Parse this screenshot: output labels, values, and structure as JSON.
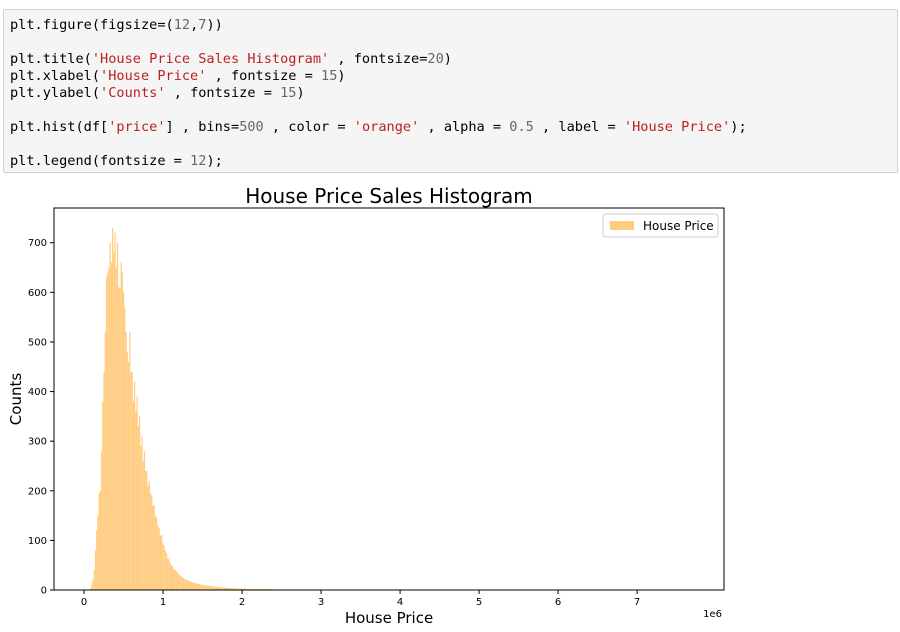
{
  "code_cell": {
    "lines": [
      [
        {
          "t": "plt.figure(figsize=("
        },
        {
          "t": "12",
          "c": "num"
        },
        {
          "t": ","
        },
        {
          "t": "7",
          "c": "num"
        },
        {
          "t": "))"
        }
      ],
      [],
      [
        {
          "t": "plt.title("
        },
        {
          "t": "'House Price Sales Histogram'",
          "c": "str"
        },
        {
          "t": " , fontsize="
        },
        {
          "t": "20",
          "c": "num"
        },
        {
          "t": ")"
        }
      ],
      [
        {
          "t": "plt.xlabel("
        },
        {
          "t": "'House Price'",
          "c": "str"
        },
        {
          "t": " , fontsize = "
        },
        {
          "t": "15",
          "c": "num"
        },
        {
          "t": ")"
        }
      ],
      [
        {
          "t": "plt.ylabel("
        },
        {
          "t": "'Counts'",
          "c": "str"
        },
        {
          "t": " , fontsize = "
        },
        {
          "t": "15",
          "c": "num"
        },
        {
          "t": ")"
        }
      ],
      [],
      [
        {
          "t": "plt.hist(df["
        },
        {
          "t": "'price'",
          "c": "str"
        },
        {
          "t": "] , bins="
        },
        {
          "t": "500",
          "c": "num"
        },
        {
          "t": " , color = "
        },
        {
          "t": "'orange'",
          "c": "str"
        },
        {
          "t": " , alpha = "
        },
        {
          "t": "0.5",
          "c": "num"
        },
        {
          "t": " , label = "
        },
        {
          "t": "'House Price'",
          "c": "str"
        },
        {
          "t": ");"
        }
      ],
      [],
      [
        {
          "t": "plt.legend(fontsize = "
        },
        {
          "t": "12",
          "c": "num"
        },
        {
          "t": ");"
        }
      ]
    ]
  },
  "colors": {
    "bar_fill": "#ffcc80",
    "code_bg": "#f5f5f5",
    "string": "#ba2121",
    "number": "#666666"
  },
  "chart_data": {
    "type": "bar",
    "title": "House Price Sales Histogram",
    "xlabel": "House Price",
    "ylabel": "Counts",
    "x_offset_label": "1e6",
    "xlim": [
      -0.38,
      8.1
    ],
    "ylim": [
      0,
      770
    ],
    "x_ticks": [
      0,
      1,
      2,
      3,
      4,
      5,
      6,
      7
    ],
    "y_ticks": [
      0,
      100,
      200,
      300,
      400,
      500,
      600,
      700
    ],
    "legend": {
      "label": "House Price",
      "position": "top-right"
    },
    "bins": 500,
    "bin_start": 0.075,
    "bin_width": 0.0155,
    "counts": [
      3,
      10,
      22,
      40,
      80,
      120,
      150,
      195,
      200,
      280,
      380,
      440,
      520,
      630,
      640,
      650,
      700,
      660,
      730,
      680,
      720,
      650,
      700,
      610,
      610,
      660,
      640,
      600,
      570,
      520,
      480,
      460,
      520,
      440,
      440,
      380,
      420,
      360,
      390,
      330,
      350,
      290,
      310,
      260,
      280,
      240,
      240,
      210,
      220,
      195,
      190,
      170,
      170,
      150,
      145,
      130,
      125,
      110,
      110,
      95,
      90,
      80,
      75,
      65,
      62,
      55,
      50,
      48,
      42,
      40,
      38,
      35,
      32,
      30,
      28,
      26,
      24,
      22,
      21,
      20,
      19,
      18,
      17,
      16,
      15,
      14,
      13,
      13,
      12,
      12,
      11,
      11,
      10,
      10,
      9,
      9,
      9,
      8,
      8,
      8,
      7,
      7,
      7,
      6,
      6,
      6,
      6,
      5,
      5,
      5,
      5,
      5,
      4,
      4,
      4,
      4,
      4,
      4,
      3,
      3,
      3,
      3,
      3,
      3,
      3,
      3,
      3,
      2,
      2,
      2,
      2,
      2,
      2,
      2,
      2,
      2,
      2,
      2,
      2,
      2,
      2,
      2,
      2,
      2,
      2,
      2,
      2,
      2,
      2,
      1,
      1,
      1,
      1,
      1,
      1,
      1,
      1,
      1,
      1,
      1,
      1,
      1,
      1,
      1,
      1,
      1,
      1,
      1,
      1,
      1,
      1,
      1,
      1,
      1,
      1,
      1,
      1,
      1,
      1,
      1,
      1,
      1,
      1,
      1,
      1,
      1,
      1,
      1,
      1,
      1,
      1,
      1,
      1,
      1,
      1,
      1,
      1,
      1,
      1,
      1,
      1,
      1,
      1,
      1,
      0,
      1,
      0,
      1,
      0,
      1,
      0,
      1,
      0,
      1,
      0,
      1,
      0,
      1,
      0,
      1,
      0,
      1,
      0,
      1,
      0,
      1,
      0,
      1,
      0,
      1,
      0,
      1,
      0,
      0,
      1,
      0,
      0,
      1,
      0,
      0,
      1,
      0,
      0,
      1,
      0,
      0,
      1,
      0,
      0,
      1,
      0,
      0,
      1,
      0,
      0,
      1,
      0,
      0,
      1,
      0,
      0,
      1,
      0,
      0,
      1,
      0,
      0,
      1,
      0,
      0,
      1,
      0,
      0,
      1,
      0,
      0,
      0,
      1,
      0,
      0,
      0,
      1,
      0,
      0,
      0,
      1,
      0,
      0,
      0,
      1,
      0,
      0,
      0,
      1,
      0,
      0,
      0,
      1,
      0,
      0,
      0,
      0,
      1,
      0,
      0,
      0,
      0,
      1,
      0,
      0,
      0,
      0,
      1,
      0,
      0,
      0,
      0,
      1,
      0,
      0,
      0,
      0,
      0,
      1,
      0,
      0,
      0,
      0,
      0,
      1,
      0,
      0,
      0,
      0,
      0,
      1,
      0,
      0,
      0,
      0,
      0,
      1,
      0,
      0,
      0,
      0,
      0,
      0,
      1,
      0,
      0,
      0,
      0,
      0,
      0,
      1,
      0,
      0,
      0,
      0,
      0,
      0,
      0,
      1,
      0,
      0,
      0,
      0,
      0,
      0,
      0,
      1,
      0,
      0,
      0,
      0,
      0,
      0,
      0,
      1,
      0,
      0,
      0,
      0,
      0,
      0,
      0,
      0,
      1,
      0,
      0,
      0,
      0,
      0,
      0,
      0,
      0,
      1,
      0,
      0,
      0,
      0,
      0,
      0,
      0,
      0,
      0,
      0,
      1,
      0,
      0,
      0,
      0,
      0,
      0,
      0,
      0,
      0,
      0,
      1,
      0,
      0,
      0,
      0,
      0,
      0,
      0,
      0,
      0,
      0,
      1,
      0,
      0,
      0,
      0,
      0,
      0,
      0,
      0,
      0,
      0,
      1,
      0,
      0,
      0,
      0,
      0,
      0,
      0,
      0,
      0,
      0,
      0,
      0,
      1,
      0,
      0,
      0,
      0,
      0,
      0,
      0,
      0,
      0,
      0,
      0,
      0,
      0,
      0,
      0,
      0,
      1,
      0,
      0,
      0,
      0,
      0,
      0,
      0,
      0,
      0,
      0,
      0,
      0,
      0,
      0,
      0,
      0,
      0,
      0,
      1,
      0,
      0,
      0,
      0,
      0,
      0,
      0,
      0,
      1
    ]
  }
}
